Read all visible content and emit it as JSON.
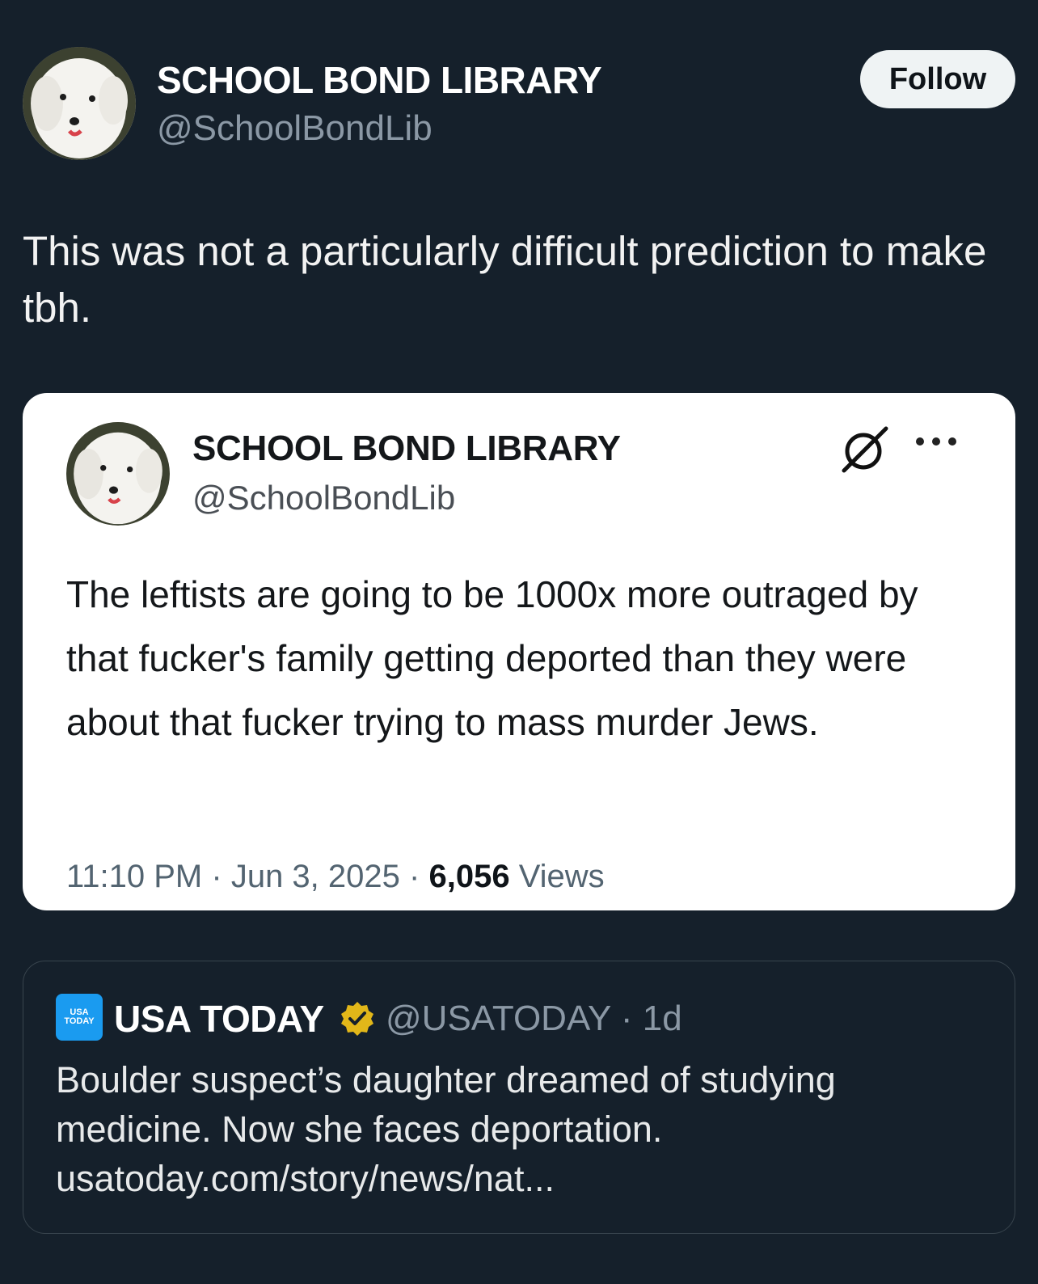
{
  "post": {
    "author_name": "SCHOOL BOND LIBRARY",
    "author_handle": "@SchoolBondLib",
    "follow_label": "Follow",
    "text": "This was not a particularly difficult prediction to make tbh."
  },
  "embedded_post": {
    "author_name": "SCHOOL BOND LIBRARY",
    "author_handle": "@SchoolBondLib",
    "text": "The leftists are going to be 1000x more outraged by that fucker's family getting deported than they were about that fucker trying to mass murder Jews.",
    "time": "11:10 PM",
    "date": "Jun 3, 2025",
    "views_count": "6,056",
    "views_label": "Views",
    "separator": "·"
  },
  "quoted_post": {
    "logo_line1": "USA",
    "logo_line2": "TODAY",
    "author_name": "USA TODAY",
    "author_handle": "@USATODAY",
    "age": "1d",
    "separator": "·",
    "headline": "Boulder suspect’s daughter dreamed of studying medicine. Now she faces deportation.",
    "link": "usatoday.com/story/news/nat..."
  },
  "colors": {
    "background": "#15202b",
    "follow_button": "#eff3f4",
    "verified_badge": "#e2b719",
    "usa_today_logo": "#1a9bf0"
  },
  "icons": {
    "grok": "grok-icon",
    "more": "more-icon",
    "verified": "verified-icon"
  }
}
